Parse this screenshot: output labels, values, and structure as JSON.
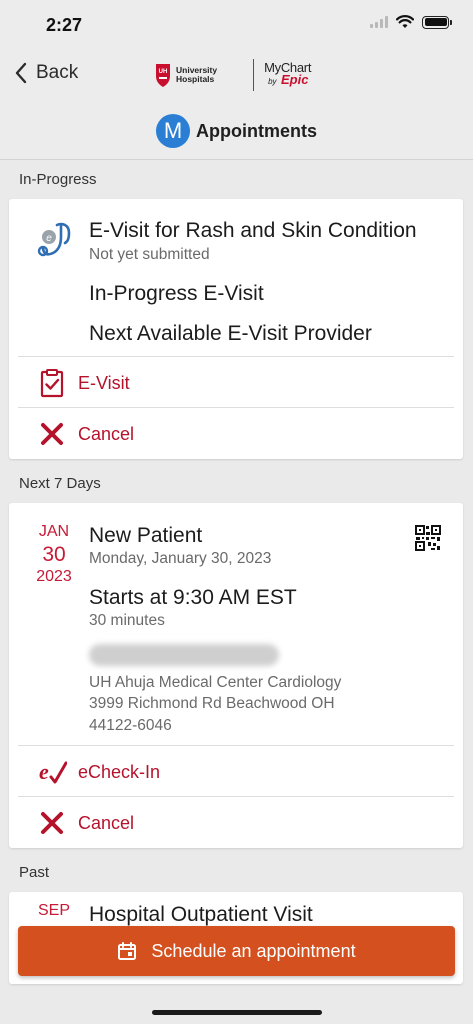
{
  "status_bar": {
    "time": "2:27"
  },
  "nav": {
    "back_label": "Back",
    "uh_logo_text_1": "University",
    "uh_logo_text_2": "Hospitals",
    "uh_badge": "UH",
    "mychart_label": "MyChart",
    "mychart_by": "by",
    "mychart_epic": "Epic",
    "avatar_initial": "M",
    "title": "Appointments"
  },
  "sections": {
    "in_progress": "In-Progress",
    "next_7_days": "Next 7 Days",
    "past": "Past"
  },
  "evisit_card": {
    "title": "E-Visit for Rash and Skin Condition",
    "status": "Not yet submitted",
    "line1": "In-Progress E-Visit",
    "line2": "Next Available E-Visit Provider",
    "action_evisit": "E-Visit",
    "action_cancel": "Cancel"
  },
  "appointment_card": {
    "month": "JAN",
    "day": "30",
    "year": "2023",
    "title": "New Patient",
    "date_full": "Monday, January 30, 2023",
    "start_time": "Starts at 9:30 AM EST",
    "duration": "30 minutes",
    "location_name": "UH Ahuja Medical Center Cardiology",
    "address_line1": "3999 Richmond Rd Beachwood OH",
    "address_line2": "44122-6046",
    "action_checkin": "eCheck-In",
    "action_cancel": "Cancel"
  },
  "past_card": {
    "month": "SEP",
    "title": "Hospital Outpatient Visit"
  },
  "schedule_button": {
    "label": "Schedule an appointment"
  },
  "colors": {
    "accent_red": "#b5122b",
    "button_orange": "#d4501e",
    "avatar_blue": "#2a7fd4"
  }
}
